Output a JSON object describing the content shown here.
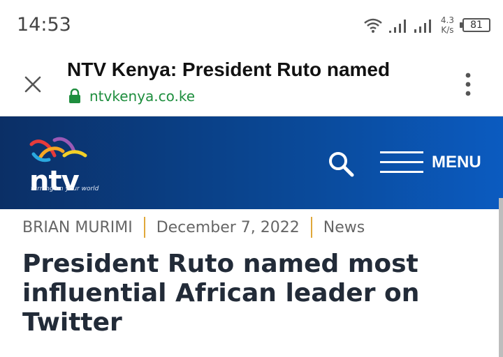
{
  "status": {
    "time": "14:53",
    "speed_value": "4.3",
    "speed_unit": "K/s",
    "battery": "81"
  },
  "browser": {
    "title": "NTV Kenya: President Ruto named",
    "url": "ntvkenya.co.ke"
  },
  "site": {
    "logo_text": "ntv",
    "tagline": "turning on your world",
    "menu_label": "MENU",
    "brand_colors": {
      "header_start": "#0b2f66",
      "header_end": "#0b5bc0"
    }
  },
  "article": {
    "author": "BRIAN MURIMI",
    "date": "December 7, 2022",
    "category": "News",
    "headline": "President Ruto named most influential African leader on Twitter"
  }
}
